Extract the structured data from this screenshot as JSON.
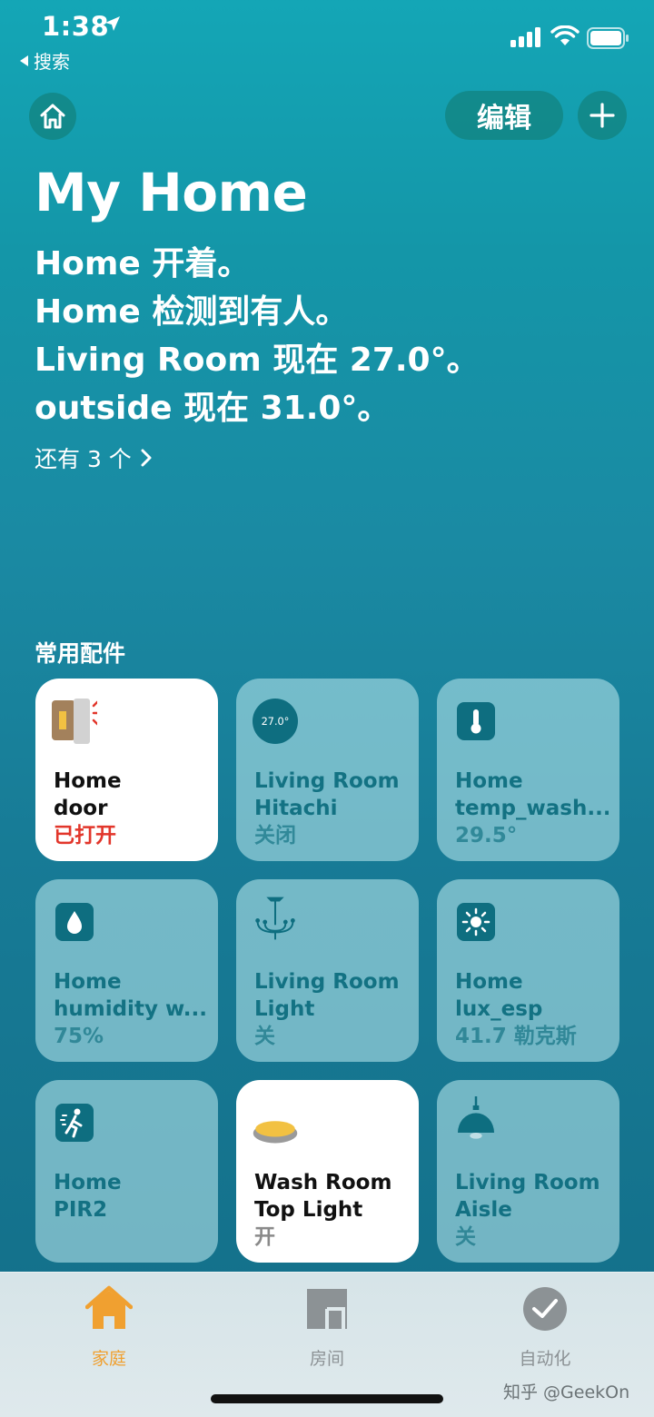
{
  "status_bar": {
    "time": "1:38",
    "back_label": "搜索"
  },
  "header": {
    "edit_label": "编辑"
  },
  "home": {
    "title": "My Home",
    "summary": [
      "Home 开着。",
      "Home 检测到有人。",
      "Living Room 现在 27.0°。",
      "outside 现在 31.0°。"
    ],
    "more_label": "还有 3 个"
  },
  "favorites": {
    "section_title": "常用配件",
    "tiles": [
      {
        "room": "Home",
        "name": "door",
        "status": "已打开",
        "icon": "door-open-icon",
        "state": "on-alert"
      },
      {
        "room": "Living Room",
        "name": "Hitachi",
        "status": "关闭",
        "icon": "thermostat-icon",
        "icon_value": "27.0°",
        "state": "off"
      },
      {
        "room": "Home",
        "name": "temp_wash...",
        "status": "29.5°",
        "icon": "thermometer-icon",
        "state": "off"
      },
      {
        "room": "Home",
        "name": "humidity w...",
        "status": "75%",
        "icon": "humidity-drop-icon",
        "state": "off"
      },
      {
        "room": "Living Room",
        "name": "Light",
        "status": "关",
        "icon": "chandelier-icon",
        "state": "off"
      },
      {
        "room": "Home",
        "name": "lux_esp",
        "status": "41.7 勒克斯",
        "icon": "light-sensor-icon",
        "state": "off"
      },
      {
        "room": "Home",
        "name": "PIR2",
        "status": "",
        "icon": "motion-sensor-icon",
        "state": "off"
      },
      {
        "room": "Wash Room",
        "name": "Top Light",
        "status": "开",
        "icon": "ceiling-light-icon",
        "state": "on"
      },
      {
        "room": "Living Room",
        "name": "Aisle",
        "status": "关",
        "icon": "pendant-lamp-icon",
        "state": "off"
      }
    ]
  },
  "tabbar": {
    "tabs": [
      {
        "label": "家庭",
        "icon": "home-tab-icon",
        "active": true
      },
      {
        "label": "房间",
        "icon": "rooms-tab-icon",
        "active": false
      },
      {
        "label": "自动化",
        "icon": "automation-tab-icon",
        "active": false
      }
    ]
  },
  "watermark": "知乎 @GeekOn",
  "colors": {
    "accent": "#f0a030",
    "alert": "#e2362b",
    "background": "#1496a8"
  }
}
